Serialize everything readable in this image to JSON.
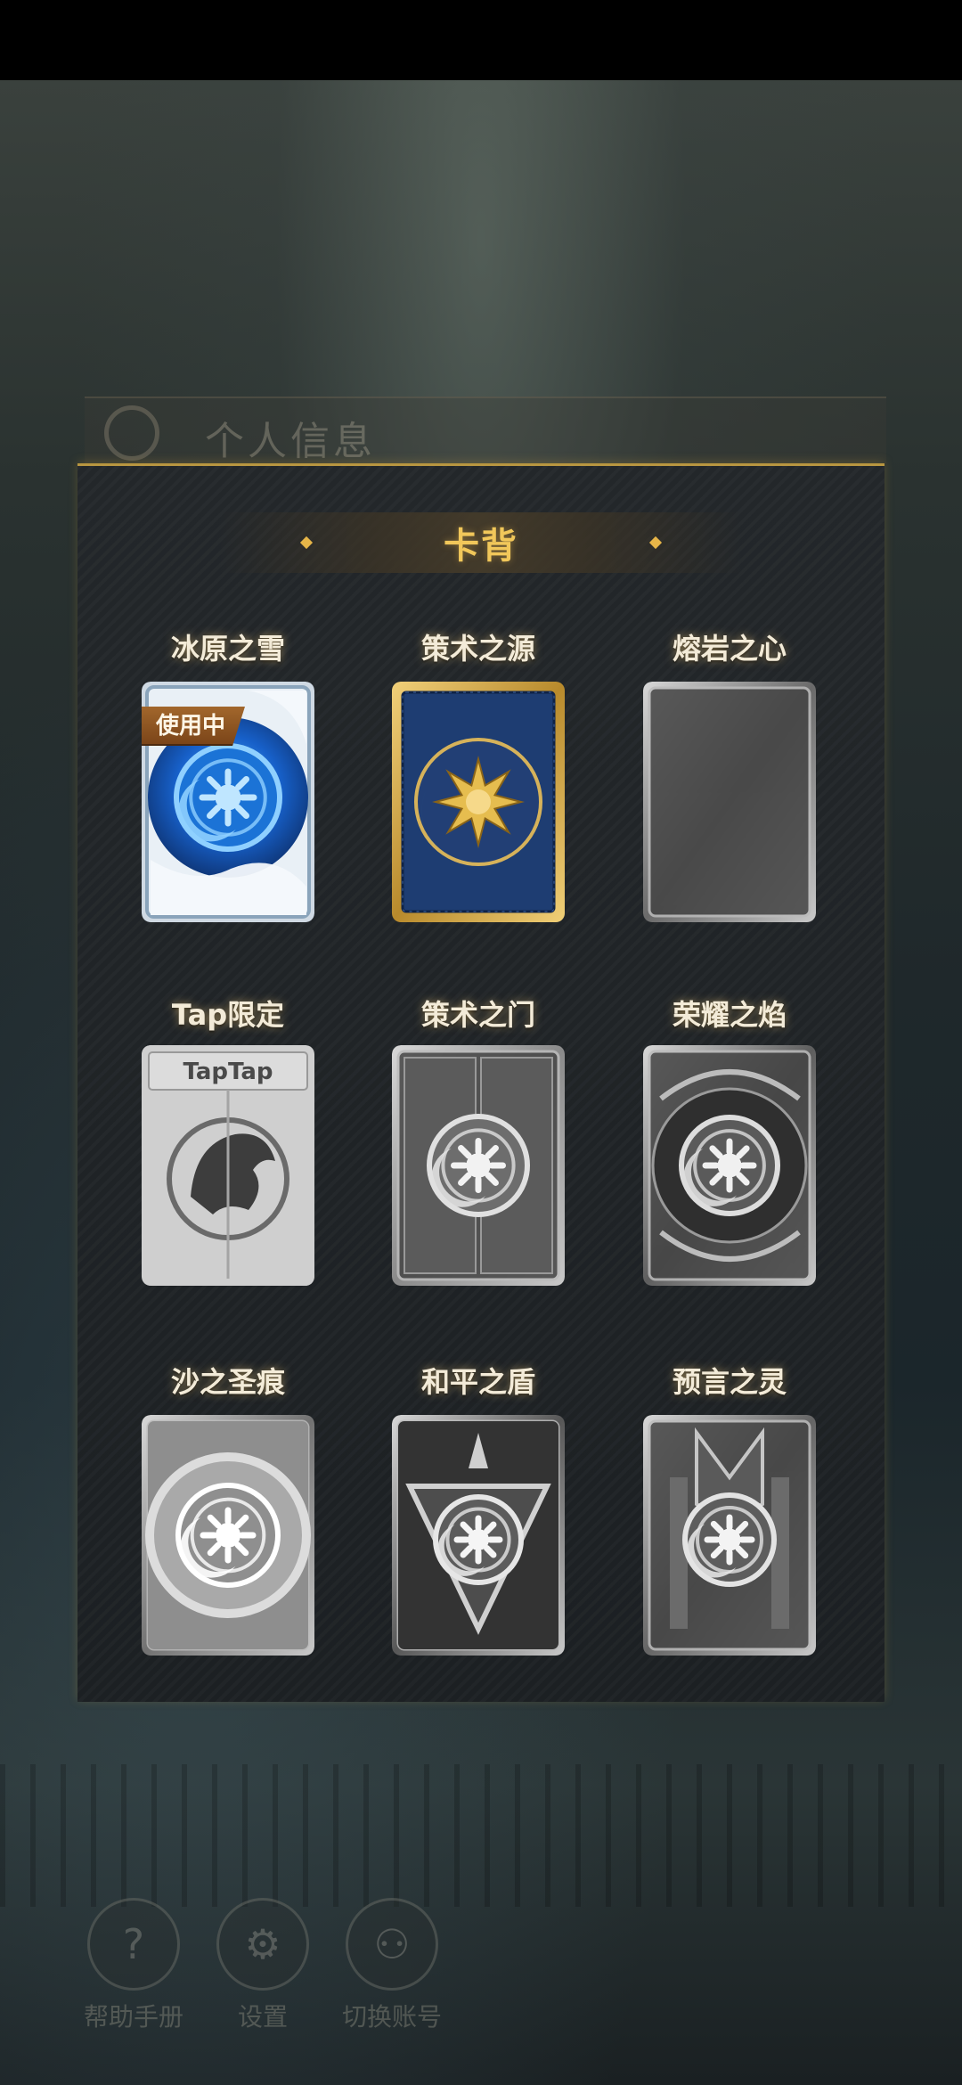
{
  "background": {
    "header_title": "个人信息",
    "bottom_nav": [
      {
        "label": "帮助手册",
        "icon": "help-manual-icon"
      },
      {
        "label": "设置",
        "icon": "gear-icon"
      },
      {
        "label": "切换账号",
        "icon": "switch-account-icon"
      }
    ]
  },
  "panel": {
    "title": "卡背",
    "accent_color": "#f1c75a"
  },
  "card_backs": [
    {
      "name": "冰原之雪",
      "status": "使用中",
      "owned": true,
      "colored": true
    },
    {
      "name": "策术之源",
      "status": "",
      "owned": true,
      "colored": true
    },
    {
      "name": "熔岩之心",
      "status": "",
      "owned": false,
      "colored": false
    },
    {
      "name": "Tap限定",
      "status": "",
      "owned": false,
      "colored": false,
      "brand_text": "TapTap"
    },
    {
      "name": "策术之门",
      "status": "",
      "owned": false,
      "colored": false
    },
    {
      "name": "荣耀之焰",
      "status": "",
      "owned": false,
      "colored": false
    },
    {
      "name": "沙之圣痕",
      "status": "",
      "owned": false,
      "colored": false
    },
    {
      "name": "和平之盾",
      "status": "",
      "owned": false,
      "colored": false
    },
    {
      "name": "预言之灵",
      "status": "",
      "owned": false,
      "colored": false
    }
  ]
}
